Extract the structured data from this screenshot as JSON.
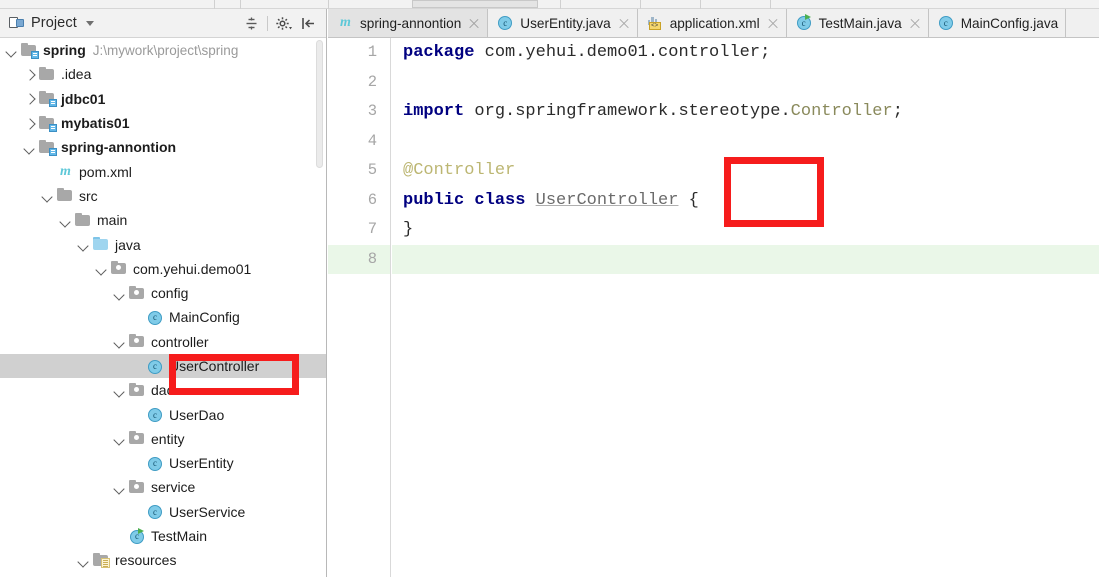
{
  "window": {
    "ide": "IntelliJ IDEA"
  },
  "project_panel": {
    "title": "Project",
    "title_icon": "project-window-icon",
    "caret_icon": "chevron-down-icon",
    "tools": [
      {
        "name": "collapse-all-icon",
        "label": "Collapse All"
      },
      {
        "name": "settings-gear-icon",
        "label": "Settings"
      },
      {
        "name": "hide-panel-icon",
        "label": "Hide"
      }
    ],
    "tree": [
      {
        "depth": 0,
        "twisty": "down",
        "icon": "module-folder-icon",
        "label": "spring",
        "bold": true,
        "path": "J:\\mywork\\project\\spring",
        "selected": false
      },
      {
        "depth": 1,
        "twisty": "right",
        "icon": "folder-gray-icon",
        "label": ".idea",
        "bold": false,
        "path": "",
        "selected": false
      },
      {
        "depth": 1,
        "twisty": "right",
        "icon": "module-folder-icon",
        "label": "jdbc01",
        "bold": true,
        "path": "",
        "selected": false
      },
      {
        "depth": 1,
        "twisty": "right",
        "icon": "module-folder-icon",
        "label": "mybatis01",
        "bold": true,
        "path": "",
        "selected": false
      },
      {
        "depth": 1,
        "twisty": "down",
        "icon": "module-folder-icon",
        "label": "spring-annontion",
        "bold": true,
        "path": "",
        "selected": false
      },
      {
        "depth": 2,
        "twisty": "none",
        "icon": "maven-pom-icon",
        "label": "pom.xml",
        "bold": false,
        "path": "",
        "selected": false
      },
      {
        "depth": 2,
        "twisty": "down",
        "icon": "folder-gray-icon",
        "label": "src",
        "bold": false,
        "path": "",
        "selected": false
      },
      {
        "depth": 3,
        "twisty": "down",
        "icon": "folder-gray-icon",
        "label": "main",
        "bold": false,
        "path": "",
        "selected": false
      },
      {
        "depth": 4,
        "twisty": "down",
        "icon": "source-folder-icon",
        "label": "java",
        "bold": false,
        "path": "",
        "selected": false
      },
      {
        "depth": 5,
        "twisty": "down",
        "icon": "package-folder-icon",
        "label": "com.yehui.demo01",
        "bold": false,
        "path": "",
        "selected": false
      },
      {
        "depth": 6,
        "twisty": "down",
        "icon": "package-folder-icon",
        "label": "config",
        "bold": false,
        "path": "",
        "selected": false
      },
      {
        "depth": 7,
        "twisty": "none",
        "icon": "java-class-icon",
        "label": "MainConfig",
        "bold": false,
        "path": "",
        "selected": false
      },
      {
        "depth": 6,
        "twisty": "down",
        "icon": "package-folder-icon",
        "label": "controller",
        "bold": false,
        "path": "",
        "selected": false
      },
      {
        "depth": 7,
        "twisty": "none",
        "icon": "java-class-icon",
        "label": "UserController",
        "bold": false,
        "path": "",
        "selected": true
      },
      {
        "depth": 6,
        "twisty": "down",
        "icon": "package-folder-icon",
        "label": "dao",
        "bold": false,
        "path": "",
        "selected": false
      },
      {
        "depth": 7,
        "twisty": "none",
        "icon": "java-class-icon",
        "label": "UserDao",
        "bold": false,
        "path": "",
        "selected": false
      },
      {
        "depth": 6,
        "twisty": "down",
        "icon": "package-folder-icon",
        "label": "entity",
        "bold": false,
        "path": "",
        "selected": false
      },
      {
        "depth": 7,
        "twisty": "none",
        "icon": "java-class-icon",
        "label": "UserEntity",
        "bold": false,
        "path": "",
        "selected": false
      },
      {
        "depth": 6,
        "twisty": "down",
        "icon": "package-folder-icon",
        "label": "service",
        "bold": false,
        "path": "",
        "selected": false
      },
      {
        "depth": 7,
        "twisty": "none",
        "icon": "java-class-icon",
        "label": "UserService",
        "bold": false,
        "path": "",
        "selected": false
      },
      {
        "depth": 6,
        "twisty": "none",
        "icon": "java-runnable-class-icon",
        "label": "TestMain",
        "bold": false,
        "path": "",
        "selected": false
      },
      {
        "depth": 4,
        "twisty": "down",
        "icon": "resources-folder-icon",
        "label": "resources",
        "bold": false,
        "path": "",
        "selected": false
      }
    ]
  },
  "editor": {
    "tabs": [
      {
        "label": "spring-annontion",
        "icon": "maven-module-icon",
        "active": true,
        "closable": true
      },
      {
        "label": "UserEntity.java",
        "icon": "java-class-icon",
        "active": false,
        "closable": true
      },
      {
        "label": "application.xml",
        "icon": "spring-xml-icon",
        "active": false,
        "closable": true
      },
      {
        "label": "TestMain.java",
        "icon": "java-runnable-class-icon",
        "active": false,
        "closable": true
      },
      {
        "label": "MainConfig.java",
        "icon": "java-class-icon",
        "active": false,
        "closable": false
      }
    ],
    "line_numbers": [
      "1",
      "2",
      "3",
      "4",
      "5",
      "6",
      "7",
      "8"
    ],
    "current_line": 8,
    "code": [
      {
        "n": 1,
        "tokens": [
          {
            "t": "package",
            "c": "kw"
          },
          {
            "t": " com.yehui.demo01.controller;",
            "c": "plain"
          }
        ]
      },
      {
        "n": 2,
        "tokens": []
      },
      {
        "n": 3,
        "tokens": [
          {
            "t": "import",
            "c": "kw"
          },
          {
            "t": " org.springframework.stereotype.",
            "c": "plain"
          },
          {
            "t": "Controller",
            "c": "cls"
          },
          {
            "t": ";",
            "c": "plain"
          }
        ]
      },
      {
        "n": 4,
        "tokens": []
      },
      {
        "n": 5,
        "tokens": [
          {
            "t": "@Controller",
            "c": "anno"
          }
        ]
      },
      {
        "n": 6,
        "tokens": [
          {
            "t": "public",
            "c": "kw"
          },
          {
            "t": " ",
            "c": "plain"
          },
          {
            "t": "class",
            "c": "kw"
          },
          {
            "t": " ",
            "c": "plain"
          },
          {
            "t": "UserController",
            "c": "typeu"
          },
          {
            "t": " {",
            "c": "plain"
          }
        ]
      },
      {
        "n": 7,
        "tokens": [
          {
            "t": "}",
            "c": "plain"
          }
        ]
      },
      {
        "n": 8,
        "tokens": []
      }
    ]
  },
  "annotations": {
    "color": "#f61c1c",
    "boxes": [
      {
        "name": "tree-usercontroller-highlight",
        "target": "UserController"
      },
      {
        "name": "code-controller-annotation-highlight",
        "target": "@Controller"
      }
    ]
  }
}
